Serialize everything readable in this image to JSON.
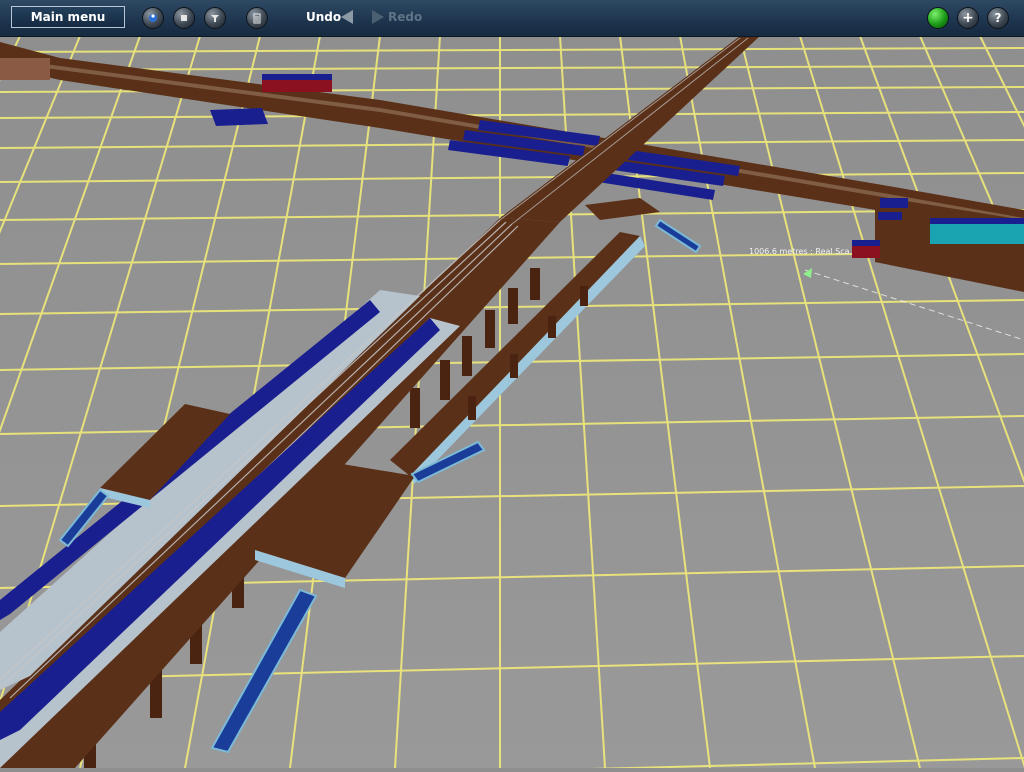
{
  "toolbar": {
    "main_menu_label": "Main menu",
    "undo_label": "Undo",
    "redo_label": "Redo",
    "left_icons": [
      "globe-icon",
      "stop-icon",
      "tool-icon",
      "trash-icon"
    ],
    "right_icons": [
      "green-status-icon",
      "plus-icon",
      "help-icon"
    ]
  },
  "viewport": {
    "measurement_readout": "1006.6 metres : Real Sca",
    "colors": {
      "ground": "#8f8f8f",
      "grid": "#f1ea7a",
      "track_bed": "#5a3018",
      "platform": "#b6c2cc",
      "canopy": "#1a1f8f",
      "stairs": "#7cb9d6"
    }
  }
}
